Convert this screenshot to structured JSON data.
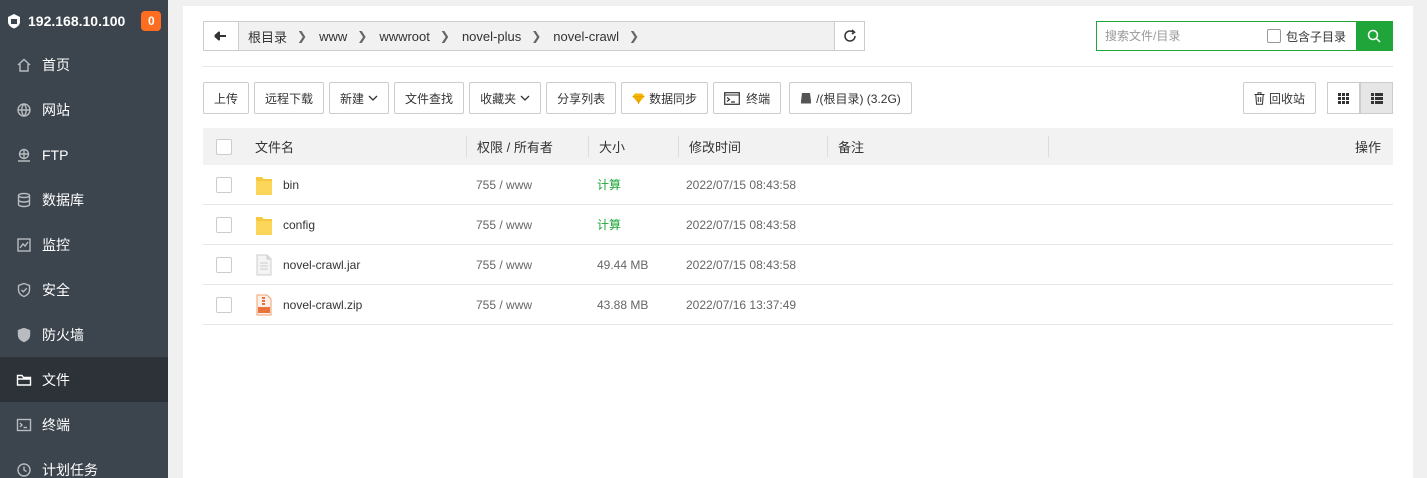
{
  "sidebar": {
    "host": "192.168.10.100",
    "badge": "0",
    "items": [
      {
        "label": "首页",
        "icon": "home-icon"
      },
      {
        "label": "网站",
        "icon": "globe-icon"
      },
      {
        "label": "FTP",
        "icon": "ftp-icon"
      },
      {
        "label": "数据库",
        "icon": "database-icon"
      },
      {
        "label": "监控",
        "icon": "monitor-icon"
      },
      {
        "label": "安全",
        "icon": "shield-icon"
      },
      {
        "label": "防火墙",
        "icon": "firewall-icon"
      },
      {
        "label": "文件",
        "icon": "folder-icon",
        "active": true
      },
      {
        "label": "终端",
        "icon": "terminal-icon"
      },
      {
        "label": "计划任务",
        "icon": "clock-icon"
      }
    ]
  },
  "path": {
    "crumbs": [
      "根目录",
      "www",
      "wwwroot",
      "novel-plus",
      "novel-crawl"
    ]
  },
  "search": {
    "placeholder": "搜索文件/目录",
    "subdir_label": "包含子目录"
  },
  "toolbar": {
    "upload": "上传",
    "remote_download": "远程下载",
    "new": "新建",
    "find": "文件查找",
    "favorites": "收藏夹",
    "share_list": "分享列表",
    "data_sync": "数据同步",
    "terminal": "终端",
    "disk": "/(根目录) (3.2G)",
    "recycle": "回收站"
  },
  "table": {
    "headers": {
      "name": "文件名",
      "perm": "权限 / 所有者",
      "size": "大小",
      "mtime": "修改时间",
      "note": "备注",
      "ops": "操作"
    },
    "rows": [
      {
        "name": "bin",
        "type": "folder",
        "perm": "755 / www",
        "size": "计算",
        "mtime": "2022/07/15 08:43:58"
      },
      {
        "name": "config",
        "type": "folder",
        "perm": "755 / www",
        "size": "计算",
        "mtime": "2022/07/15 08:43:58"
      },
      {
        "name": "novel-crawl.jar",
        "type": "file",
        "perm": "755 / www",
        "size": "49.44 MB",
        "mtime": "2022/07/15 08:43:58"
      },
      {
        "name": "novel-crawl.zip",
        "type": "zip",
        "perm": "755 / www",
        "size": "43.88 MB",
        "mtime": "2022/07/16 13:37:49"
      }
    ]
  },
  "colors": {
    "accent": "#20a53a",
    "sidebar_bg": "#3c444d",
    "badge": "#ff6d20"
  }
}
